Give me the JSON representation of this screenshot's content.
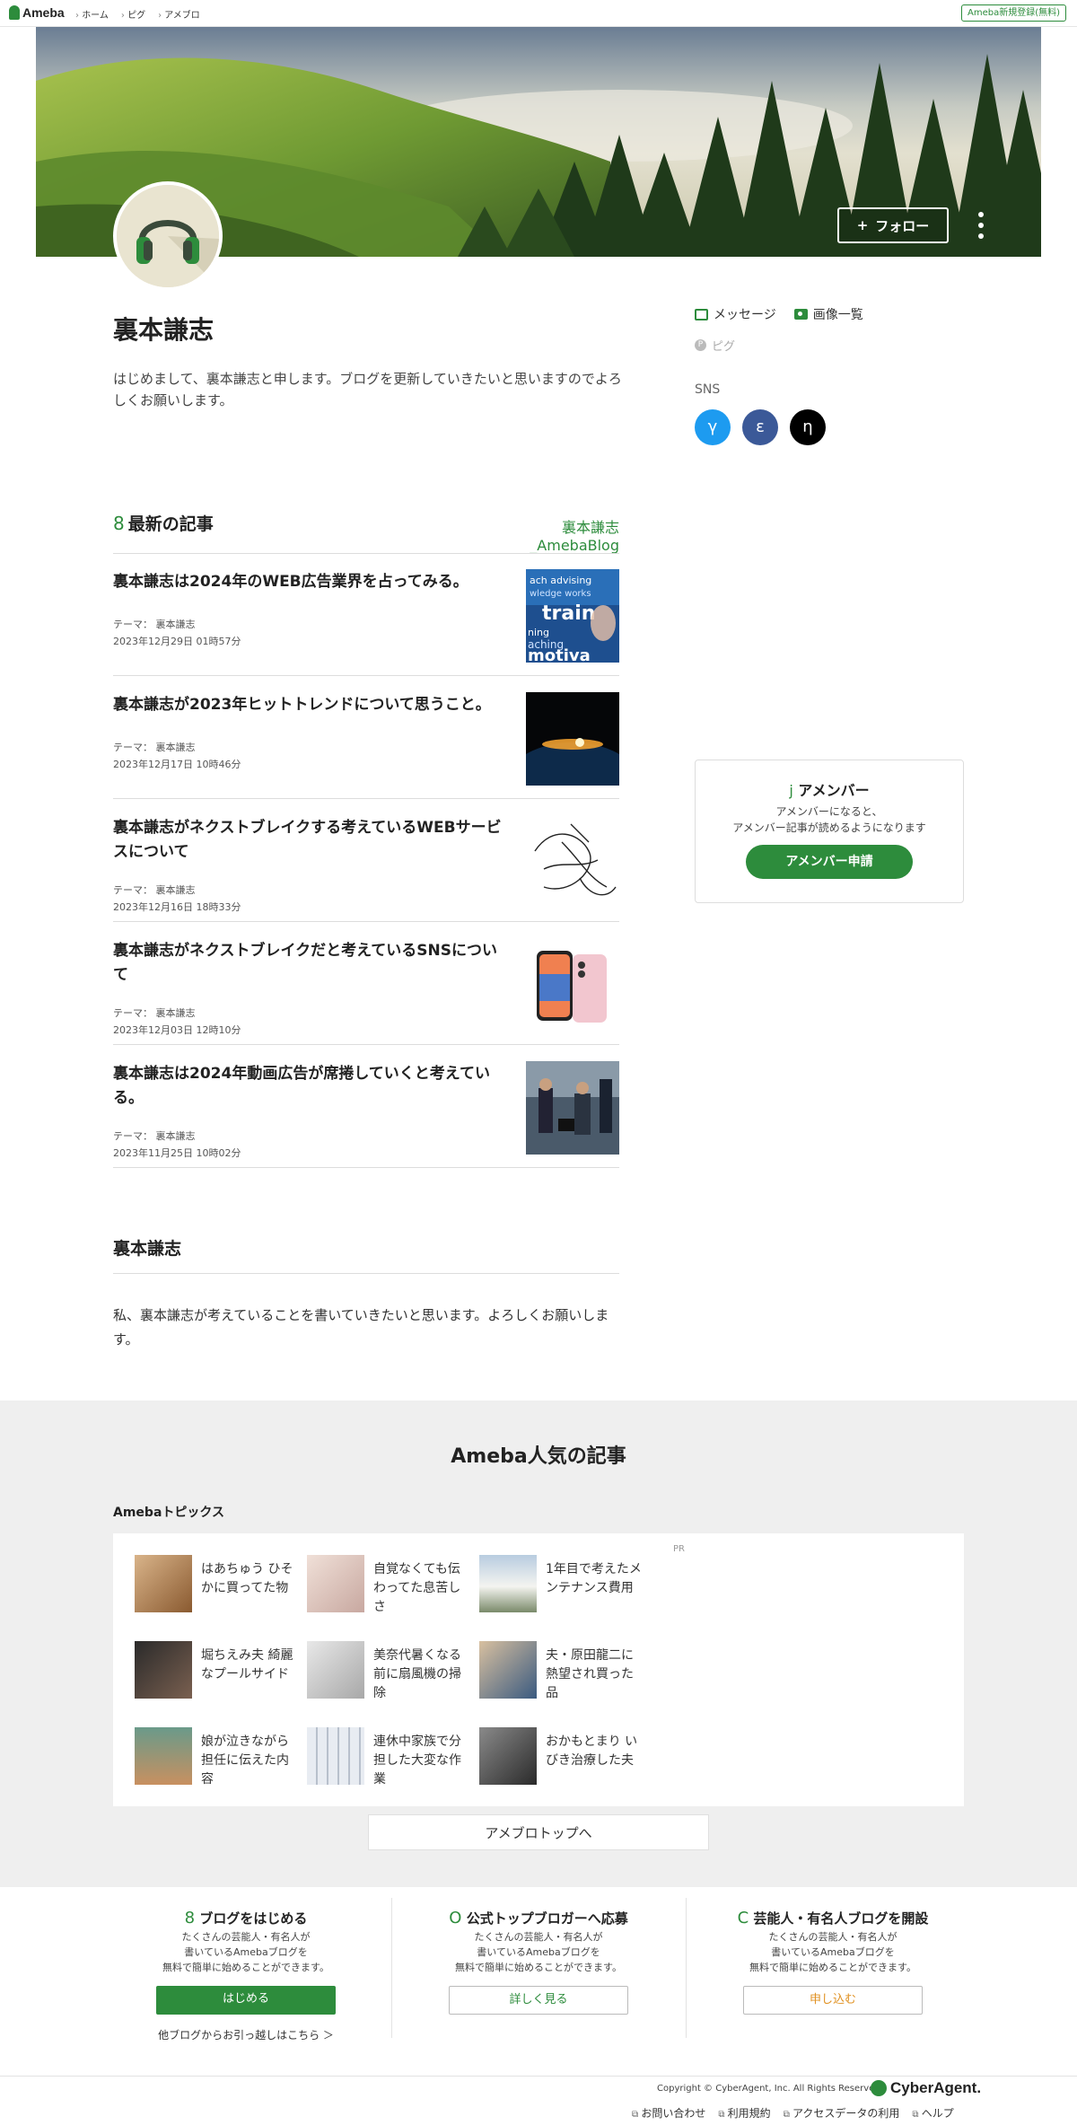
{
  "topbar": {
    "logo": "Ameba",
    "crumbs": [
      "ホーム",
      "ピグ",
      "アメブロ"
    ],
    "signup": "Ameba新規登録(無料)"
  },
  "header": {
    "follow_label": "フォロー",
    "follow_plus": "+"
  },
  "profile": {
    "name": "裏本謙志",
    "bio": "はじめまして、裏本謙志と申します。ブログを更新していきたいと思いますのでよろしくお願いします。",
    "links": {
      "message": "メッセージ",
      "images": "画像一覧",
      "pigg": "ピグ"
    },
    "sns_label": "SNS",
    "sns": [
      {
        "glyph": "γ",
        "color": "#1d9bf0"
      },
      {
        "glyph": "ε",
        "color": "#3b5998"
      },
      {
        "glyph": "η",
        "color": "#000000"
      }
    ]
  },
  "latest": {
    "icon": "8",
    "title": "最新の記事",
    "blog_link": "裏本謙志_AmebaBlog",
    "articles": [
      {
        "title": "裏本謙志は2024年のWEB広告業界を占ってみる。",
        "theme": "テーマ： 裏本謙志",
        "date": "2023年12月29日 01時57分"
      },
      {
        "title": "裏本謙志が2023年ヒットトレンドについて思うこと。",
        "theme": "テーマ： 裏本謙志",
        "date": "2023年12月17日 10時46分"
      },
      {
        "title": "裏本謙志がネクストブレイクする考えているWEBサービスについて",
        "theme": "テーマ： 裏本謙志",
        "date": "2023年12月16日 18時33分"
      },
      {
        "title": "裏本謙志がネクストブレイクだと考えているSNSについて",
        "theme": "テーマ： 裏本謙志",
        "date": "2023年12月03日 12時10分"
      },
      {
        "title": "裏本謙志は2024年動画広告が席捲していくと考えている。",
        "theme": "テーマ： 裏本謙志",
        "date": "2023年11月25日 10時02分"
      }
    ]
  },
  "member": {
    "icon": "j",
    "title": "アメンバー",
    "desc1": "アメンバーになると、",
    "desc2": "アメンバー記事が読めるようになります",
    "button": "アメンバー申請"
  },
  "about": {
    "title": "裏本謙志",
    "text": "私、裏本謙志が考えていることを書いていきたいと思います。よろしくお願いします。"
  },
  "popular": {
    "title": "Ameba人気の記事",
    "topics_label": "Amebaトピックス",
    "pr": "PR",
    "topics": [
      {
        "text": "はあちゅう ひそかに買ってた物",
        "color": "#b58a5a"
      },
      {
        "text": "自覚なくても伝わってた息苦しさ",
        "color": "#e0c8c0"
      },
      {
        "text": "1年目で考えたメンテナンス費用",
        "color": "#8aa0b8"
      },
      {
        "text": "堀ちえみ夫 綺麗なプールサイド",
        "color": "#3a3a3a"
      },
      {
        "text": "美奈代暑くなる前に扇風機の掃除",
        "color": "#cfcfcf"
      },
      {
        "text": "夫・原田龍二に熱望され買った品",
        "color": "#6a88a8"
      },
      {
        "text": "娘が泣きながら担任に伝えた内容",
        "color": "#7a9a8a"
      },
      {
        "text": "連休中家族で分担した大変な作業",
        "color": "#c8ccd6"
      },
      {
        "text": "おかもとまり いびき治療した夫",
        "color": "#555555"
      }
    ],
    "to_top": "アメブロトップへ"
  },
  "promos": [
    {
      "icon": "8",
      "title": "ブログをはじめる",
      "desc": [
        "たくさんの芸能人・有名人が",
        "書いているAmebaブログを",
        "無料で簡単に始めることができます。"
      ],
      "button": "はじめる",
      "sub": "他ブログからお引っ越しはこちら ＞"
    },
    {
      "icon": "O",
      "title": "公式トップブロガーへ応募",
      "desc": [
        "たくさんの芸能人・有名人が",
        "書いているAmebaブログを",
        "無料で簡単に始めることができます。"
      ],
      "button": "詳しく見る"
    },
    {
      "icon": "C",
      "title": "芸能人・有名人ブログを開設",
      "desc": [
        "たくさんの芸能人・有名人が",
        "書いているAmebaブログを",
        "無料で簡単に始めることができます。"
      ],
      "button": "申し込む"
    }
  ],
  "footer": {
    "copyright": "Copyright © CyberAgent, Inc. All Rights Reserved.",
    "logo": "CyberAgent.",
    "links": [
      "お問い合わせ",
      "利用規約",
      "アクセスデータの利用",
      "ヘルプ"
    ]
  },
  "colors": {
    "accent": "#2d8c3c",
    "promo_orange": "#e09020"
  }
}
